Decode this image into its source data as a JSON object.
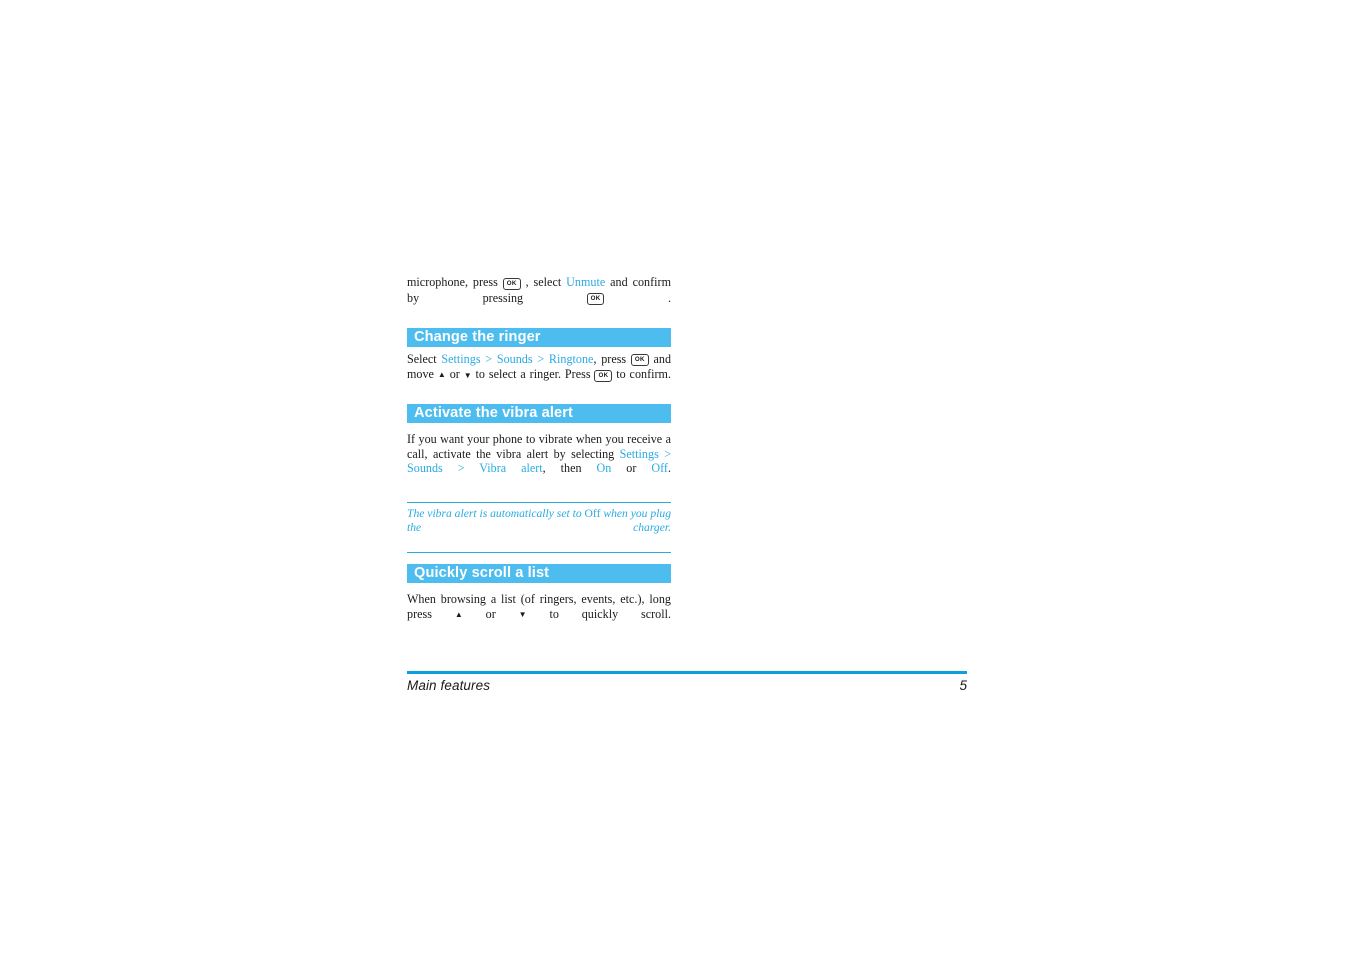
{
  "document": {
    "page_number": "5",
    "footer_label": "Main features",
    "colors": {
      "section_bar_bg": "#4DBCEF",
      "section_bar_text": "#FFFFFF",
      "reference_link": "#29ABE2",
      "note_text": "#29ABE2",
      "footer_rule": "#0E9FE0",
      "body_text": "#1A1A1A"
    }
  },
  "intro_paragraph": {
    "text_1": "microphone, press",
    "key_1": "OK",
    "text_2": ", select",
    "ref_1": "Unmute",
    "text_3": "and confirm by pressing",
    "key_2": "OK",
    "text_4": "."
  },
  "sections": [
    {
      "id": "change-the-ringer",
      "heading": "Change the ringer",
      "body": {
        "text_1": "Select",
        "ref_1": "Settings",
        "sep_1": ">",
        "ref_2": "Sounds",
        "sep_2": ">",
        "ref_3": "Ringtone",
        "text_2": ", press",
        "key_1": "OK",
        "text_3": "and move",
        "icon_up": "▲",
        "text_4": "or",
        "icon_down": "▼",
        "text_5": "to select a ringer. Press",
        "key_2": "OK",
        "text_6": "to confirm."
      }
    },
    {
      "id": "activate-the-vibra-alert",
      "heading": "Activate the vibra alert",
      "body": {
        "text_1": "If you want your phone to vibrate when you receive a call, activate the vibra alert by selecting",
        "ref_1": "Settings",
        "sep_1": ">",
        "ref_2": "Sounds",
        "sep_2": ">",
        "ref_3": "Vibra alert",
        "text_2": ", then",
        "ref_4": "On",
        "text_3": "or",
        "ref_5": "Off",
        "text_4": "."
      },
      "note": {
        "text_1": "The vibra alert is automatically set to",
        "upright_1": "Off",
        "text_2": "when you plug the charger."
      }
    },
    {
      "id": "quickly-scroll-a-list",
      "heading": "Quickly scroll a list",
      "body": {
        "text_1": "When browsing a list (of ringers, events, etc.), long press",
        "icon_up": "▲",
        "text_2": "or",
        "icon_down": "▼",
        "text_3": "to quickly scroll."
      }
    }
  ]
}
